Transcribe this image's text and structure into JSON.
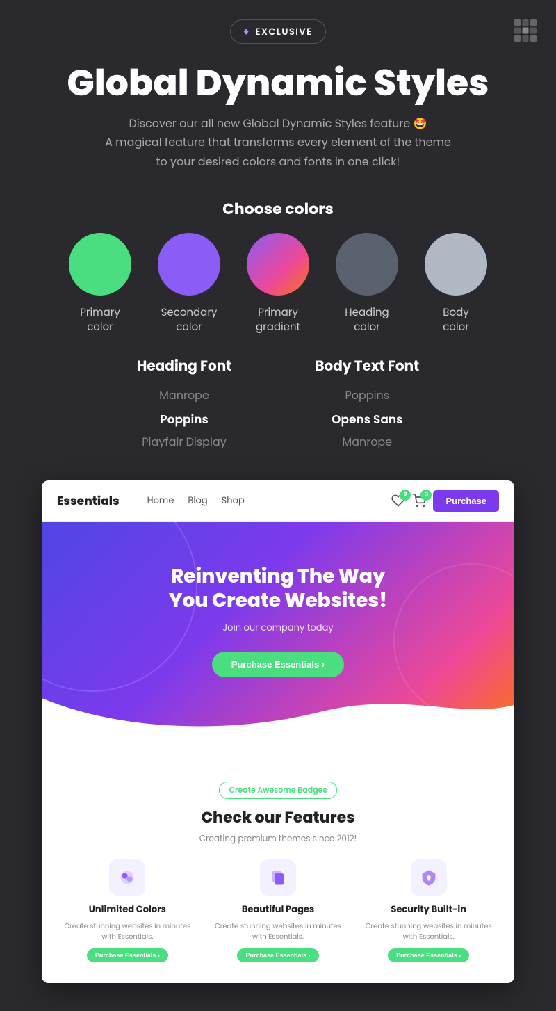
{
  "page": {
    "background": "#2a2a2e"
  },
  "topbar": {
    "badge_label": "EXCLUSIVE",
    "badge_diamond": "♦"
  },
  "hero": {
    "title": "Global Dynamic Styles",
    "subtitle_line1": "Discover our all new Global Dynamic Styles feature 🤩",
    "subtitle_line2": "A magical feature that transforms every element of the theme",
    "subtitle_line3": "to your desired colors and fonts in one click!"
  },
  "colors_section": {
    "title": "Choose colors",
    "items": [
      {
        "label": "Primary\ncolor",
        "color": "#4ade80",
        "type": "solid"
      },
      {
        "label": "Secondary\ncolor",
        "color": "#8b5cf6",
        "type": "solid"
      },
      {
        "label": "Primary\ngradient",
        "color": "gradient",
        "type": "gradient"
      },
      {
        "label": "Heading\ncolor",
        "color": "#5a6270",
        "type": "solid"
      },
      {
        "label": "Body\ncolor",
        "color": "#b0b8c4",
        "type": "solid"
      }
    ]
  },
  "fonts_section": {
    "heading_font": {
      "title": "Heading Font",
      "options": [
        "Manrope",
        "Poppins",
        "Playfair Display"
      ],
      "active": "Poppins"
    },
    "body_font": {
      "title": "Body Text Font",
      "options": [
        "Poppins",
        "Opens Sans",
        "Manrope"
      ],
      "active": "Opens Sans"
    }
  },
  "preview": {
    "nav": {
      "brand": "Essentials",
      "links": [
        "Home",
        "Blog",
        "Shop"
      ],
      "wishlist_count": "2",
      "cart_count": "3",
      "purchase_btn": "Purchase"
    },
    "hero": {
      "title_line1": "Reinventing The Way",
      "title_line2": "You Create Websites!",
      "subtitle": "Join our company today",
      "cta_btn": "Purchase Essentials  ›"
    },
    "features": {
      "badge": "Create Awesome Badges",
      "title": "Check our Features",
      "subtitle": "Creating premium themes since 2012!",
      "items": [
        {
          "icon": "🎨",
          "icon_bg": "#f3f0ff",
          "name": "Unlimited Colors",
          "desc": "Create stunning websites in minutes with Essentials.",
          "btn": "Purchase Essentials ›"
        },
        {
          "icon": "📄",
          "icon_bg": "#f3f0ff",
          "name": "Beautiful Pages",
          "desc": "Create stunning websites in minutes with Essentials.",
          "btn": "Purchase Essentials ›"
        },
        {
          "icon": "🔒",
          "icon_bg": "#f3f0ff",
          "name": "Security Built-in",
          "desc": "Create stunning websites in minutes with Essentials.",
          "btn": "Purchase Essentials ›"
        }
      ]
    }
  }
}
